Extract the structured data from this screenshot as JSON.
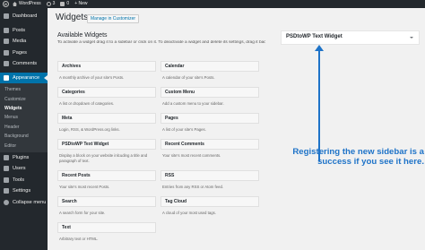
{
  "adminbar": {
    "site_name": "WordPress",
    "updates_count": "3",
    "comments_count": "0",
    "new_label": "+ New"
  },
  "sidebar": {
    "items_top": [
      {
        "label": "Dashboard",
        "icon": "dashboard-icon"
      }
    ],
    "items_mid": [
      {
        "label": "Posts",
        "icon": "pin-icon"
      },
      {
        "label": "Media",
        "icon": "media-icon"
      },
      {
        "label": "Pages",
        "icon": "page-icon"
      },
      {
        "label": "Comments",
        "icon": "comment-icon"
      }
    ],
    "appearance": "Appearance",
    "submenu": [
      "Themes",
      "Customize",
      "Widgets",
      "Menus",
      "Header",
      "Background",
      "Editor"
    ],
    "items_bottom": [
      {
        "label": "Plugins",
        "icon": "plugin-icon"
      },
      {
        "label": "Users",
        "icon": "users-icon"
      },
      {
        "label": "Tools",
        "icon": "tools-icon"
      },
      {
        "label": "Settings",
        "icon": "settings-icon"
      }
    ],
    "collapse": "Collapse menu"
  },
  "page": {
    "title": "Widgets",
    "manage_button": "Manage in Customizer",
    "available_title": "Available Widgets",
    "instructions": "To activate a widget drag it to a sidebar or click on it. To deactivate a widget and delete its settings, drag it back."
  },
  "widgets": [
    {
      "name": "Archives",
      "desc": "A monthly archive of your site's Posts."
    },
    {
      "name": "Calendar",
      "desc": "A calendar of your site's Posts."
    },
    {
      "name": "Categories",
      "desc": "A list or dropdown of categories."
    },
    {
      "name": "Custom Menu",
      "desc": "Add a custom menu to your sidebar."
    },
    {
      "name": "Meta",
      "desc": "Login, RSS, & WordPress.org links."
    },
    {
      "name": "Pages",
      "desc": "A list of your site's Pages."
    },
    {
      "name": "PSDtoWP Text Widget",
      "desc": "Display a block on your website inlcuding a title and paragraph of text."
    },
    {
      "name": "Recent Comments",
      "desc": "Your site's most recent comments."
    },
    {
      "name": "Recent Posts",
      "desc": "Your site's most recent Posts."
    },
    {
      "name": "RSS",
      "desc": "Entries from any RSS or Atom feed."
    },
    {
      "name": "Search",
      "desc": "A search form for your site."
    },
    {
      "name": "Tag Cloud",
      "desc": "A cloud of your most used tags."
    },
    {
      "name": "Text",
      "desc": "Arbitrary text or HTML."
    }
  ],
  "side_panel": {
    "title": "PSDtoWP Text Widget"
  },
  "annotation": {
    "text": "Registering the new sidebar is a success if you see it here.",
    "color": "#1e73c8"
  },
  "colors": {
    "admin_dark": "#23282d",
    "active_blue": "#0073aa"
  }
}
